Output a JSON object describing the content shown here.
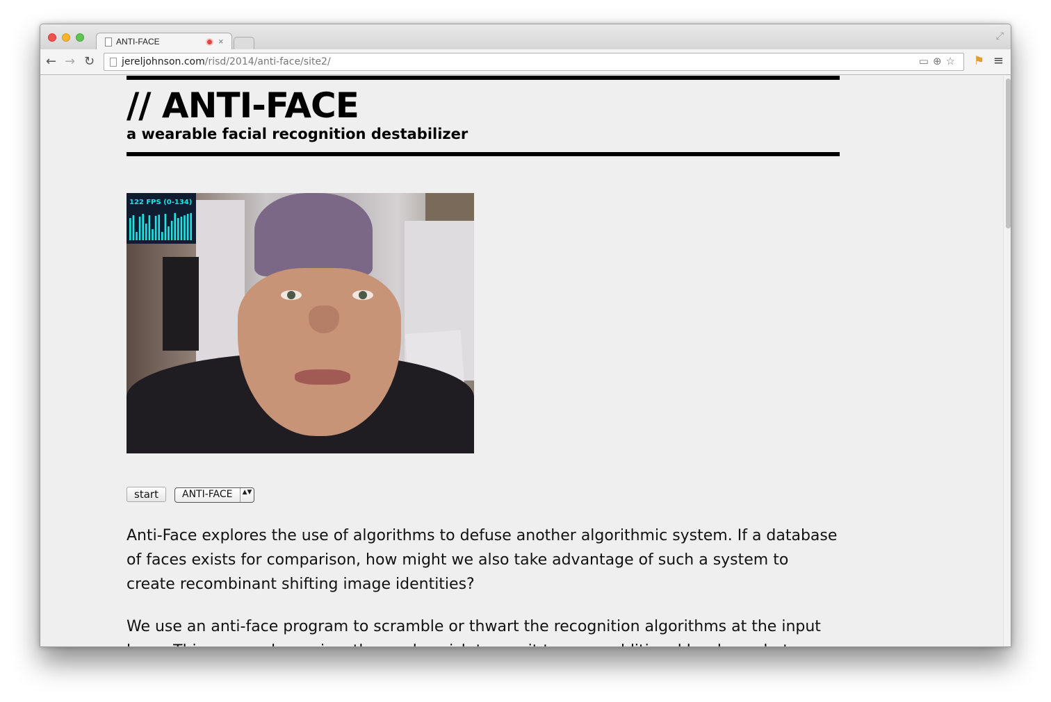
{
  "browser": {
    "tab_title": "ANTI-FACE",
    "tab_close": "×",
    "url_host": "jereljohnson.com",
    "url_path": "/risd/2014/anti-face/site2/"
  },
  "page": {
    "title": "// ANTI-FACE",
    "subtitle": "a wearable facial recognition destabilizer",
    "video": {
      "stats_label": "122 FPS (0-134)",
      "fps_history": [
        0.8,
        0.9,
        0.3,
        0.85,
        0.95,
        0.6,
        0.9,
        0.4,
        0.88,
        0.92,
        0.3,
        0.95,
        0.5,
        0.7,
        0.98,
        0.8,
        0.85,
        0.9,
        0.95,
        0.98
      ],
      "stats_color": "#18e5e5"
    },
    "controls": {
      "start_label": "start",
      "select_value": "ANTI-FACE",
      "select_arrows": "▲▼"
    },
    "paragraphs": [
      "Anti-Face explores the use of algorithms to defuse another algorithmic system. If a database of faces exists for comparison, how might we also take advantage of such a system to create recombinant shifting image identities?",
      "We use an anti-face program to scramble or thwart the recognition algorithms at the input layer. This approach requires those who wish to use it to wear additional hardware but"
    ]
  }
}
